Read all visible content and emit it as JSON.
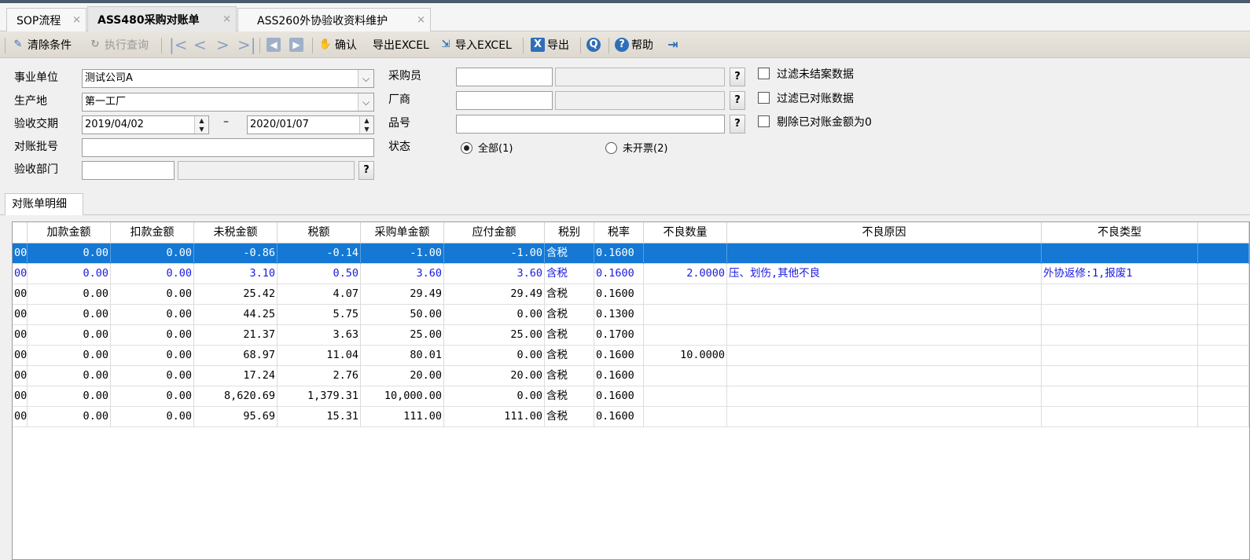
{
  "tabs": [
    {
      "label": "SOP流程",
      "active": false
    },
    {
      "label": "ASS480采购对账单",
      "active": true
    },
    {
      "label": "ASS260外协验收资料维护",
      "active": false
    }
  ],
  "toolbar": {
    "clear": "清除条件",
    "query": "执行查询",
    "confirm": "确认",
    "export_excel": "导出EXCEL",
    "import_excel": "导入EXCEL",
    "export": "导出",
    "help": "帮助"
  },
  "form": {
    "business_unit": {
      "label": "事业单位",
      "value": "测试公司A"
    },
    "production_site": {
      "label": "生产地",
      "value": "第一工厂"
    },
    "acceptance_period": {
      "label": "验收交期",
      "from": "2019/04/02",
      "dash": "–",
      "to": "2020/01/07"
    },
    "batch_no": {
      "label": "对账批号",
      "value": ""
    },
    "acceptance_dept": {
      "label": "验收部门",
      "code": "",
      "name": ""
    },
    "buyer": {
      "label": "采购员",
      "code": "",
      "name": ""
    },
    "vendor": {
      "label": "厂商",
      "code": "",
      "name": ""
    },
    "part_no": {
      "label": "品号",
      "value": ""
    },
    "status": {
      "label": "状态",
      "options": [
        "全部(1)",
        "未开票(2)"
      ],
      "selected": 0
    },
    "checkboxes": [
      "过滤未结案数据",
      "过滤已对账数据",
      "剔除已对账金额为0"
    ],
    "q": "?"
  },
  "detail_tab": "对账单明细",
  "grid": {
    "columns": [
      "",
      "加款金额",
      "扣款金额",
      "未税金额",
      "税额",
      "采购单金额",
      "应付金额",
      "税别",
      "税率",
      "不良数量",
      "不良原因",
      "不良类型",
      ""
    ],
    "rows": [
      [
        "00",
        "0.00",
        "0.00",
        "-0.86",
        "-0.14",
        "-1.00",
        "-1.00",
        "含税",
        "0.1600",
        "",
        "",
        "",
        ""
      ],
      [
        "00",
        "0.00",
        "0.00",
        "3.10",
        "0.50",
        "3.60",
        "3.60",
        "含税",
        "0.1600",
        "2.0000",
        "压、划伤,其他不良",
        "外协返修:1,报废1",
        ""
      ],
      [
        "00",
        "0.00",
        "0.00",
        "25.42",
        "4.07",
        "29.49",
        "29.49",
        "含税",
        "0.1600",
        "",
        "",
        "",
        ""
      ],
      [
        "00",
        "0.00",
        "0.00",
        "44.25",
        "5.75",
        "50.00",
        "0.00",
        "含税",
        "0.1300",
        "",
        "",
        "",
        ""
      ],
      [
        "00",
        "0.00",
        "0.00",
        "21.37",
        "3.63",
        "25.00",
        "25.00",
        "含税",
        "0.1700",
        "",
        "",
        "",
        ""
      ],
      [
        "00",
        "0.00",
        "0.00",
        "68.97",
        "11.04",
        "80.01",
        "0.00",
        "含税",
        "0.1600",
        "10.0000",
        "",
        "",
        ""
      ],
      [
        "00",
        "0.00",
        "0.00",
        "17.24",
        "2.76",
        "20.00",
        "20.00",
        "含税",
        "0.1600",
        "",
        "",
        "",
        ""
      ],
      [
        "00",
        "0.00",
        "0.00",
        "8,620.69",
        "1,379.31",
        "10,000.00",
        "0.00",
        "含税",
        "0.1600",
        "",
        "",
        "",
        ""
      ],
      [
        "00",
        "0.00",
        "0.00",
        "95.69",
        "15.31",
        "111.00",
        "111.00",
        "含税",
        "0.1600",
        "",
        "",
        "",
        ""
      ]
    ],
    "selected_row": 0,
    "highlight_row": 1
  }
}
